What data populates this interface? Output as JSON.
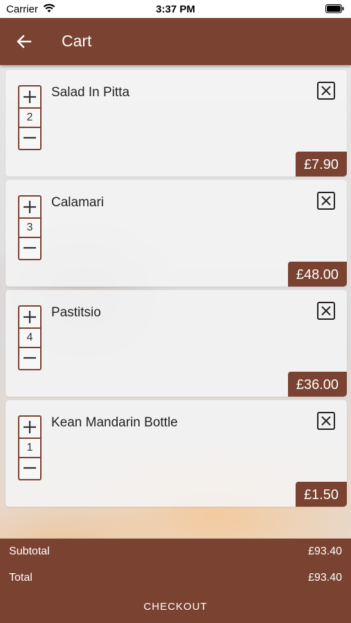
{
  "status_bar": {
    "carrier": "Carrier",
    "time": "3:37 PM"
  },
  "nav": {
    "title": "Cart",
    "back_icon": "arrow-left-icon"
  },
  "colors": {
    "brand": "#7a4230"
  },
  "cart": {
    "items": [
      {
        "name": "Salad In Pitta",
        "quantity": "2",
        "price": "£7.90"
      },
      {
        "name": "Calamari",
        "quantity": "3",
        "price": "£48.00"
      },
      {
        "name": "Pastitsio",
        "quantity": "4",
        "price": "£36.00"
      },
      {
        "name": "Kean Mandarin Bottle",
        "quantity": "1",
        "price": "£1.50"
      }
    ]
  },
  "summary": {
    "subtotal_label": "Subtotal",
    "subtotal_value": "£93.40",
    "total_label": "Total",
    "total_value": "£93.40",
    "checkout_label": "CHECKOUT"
  }
}
